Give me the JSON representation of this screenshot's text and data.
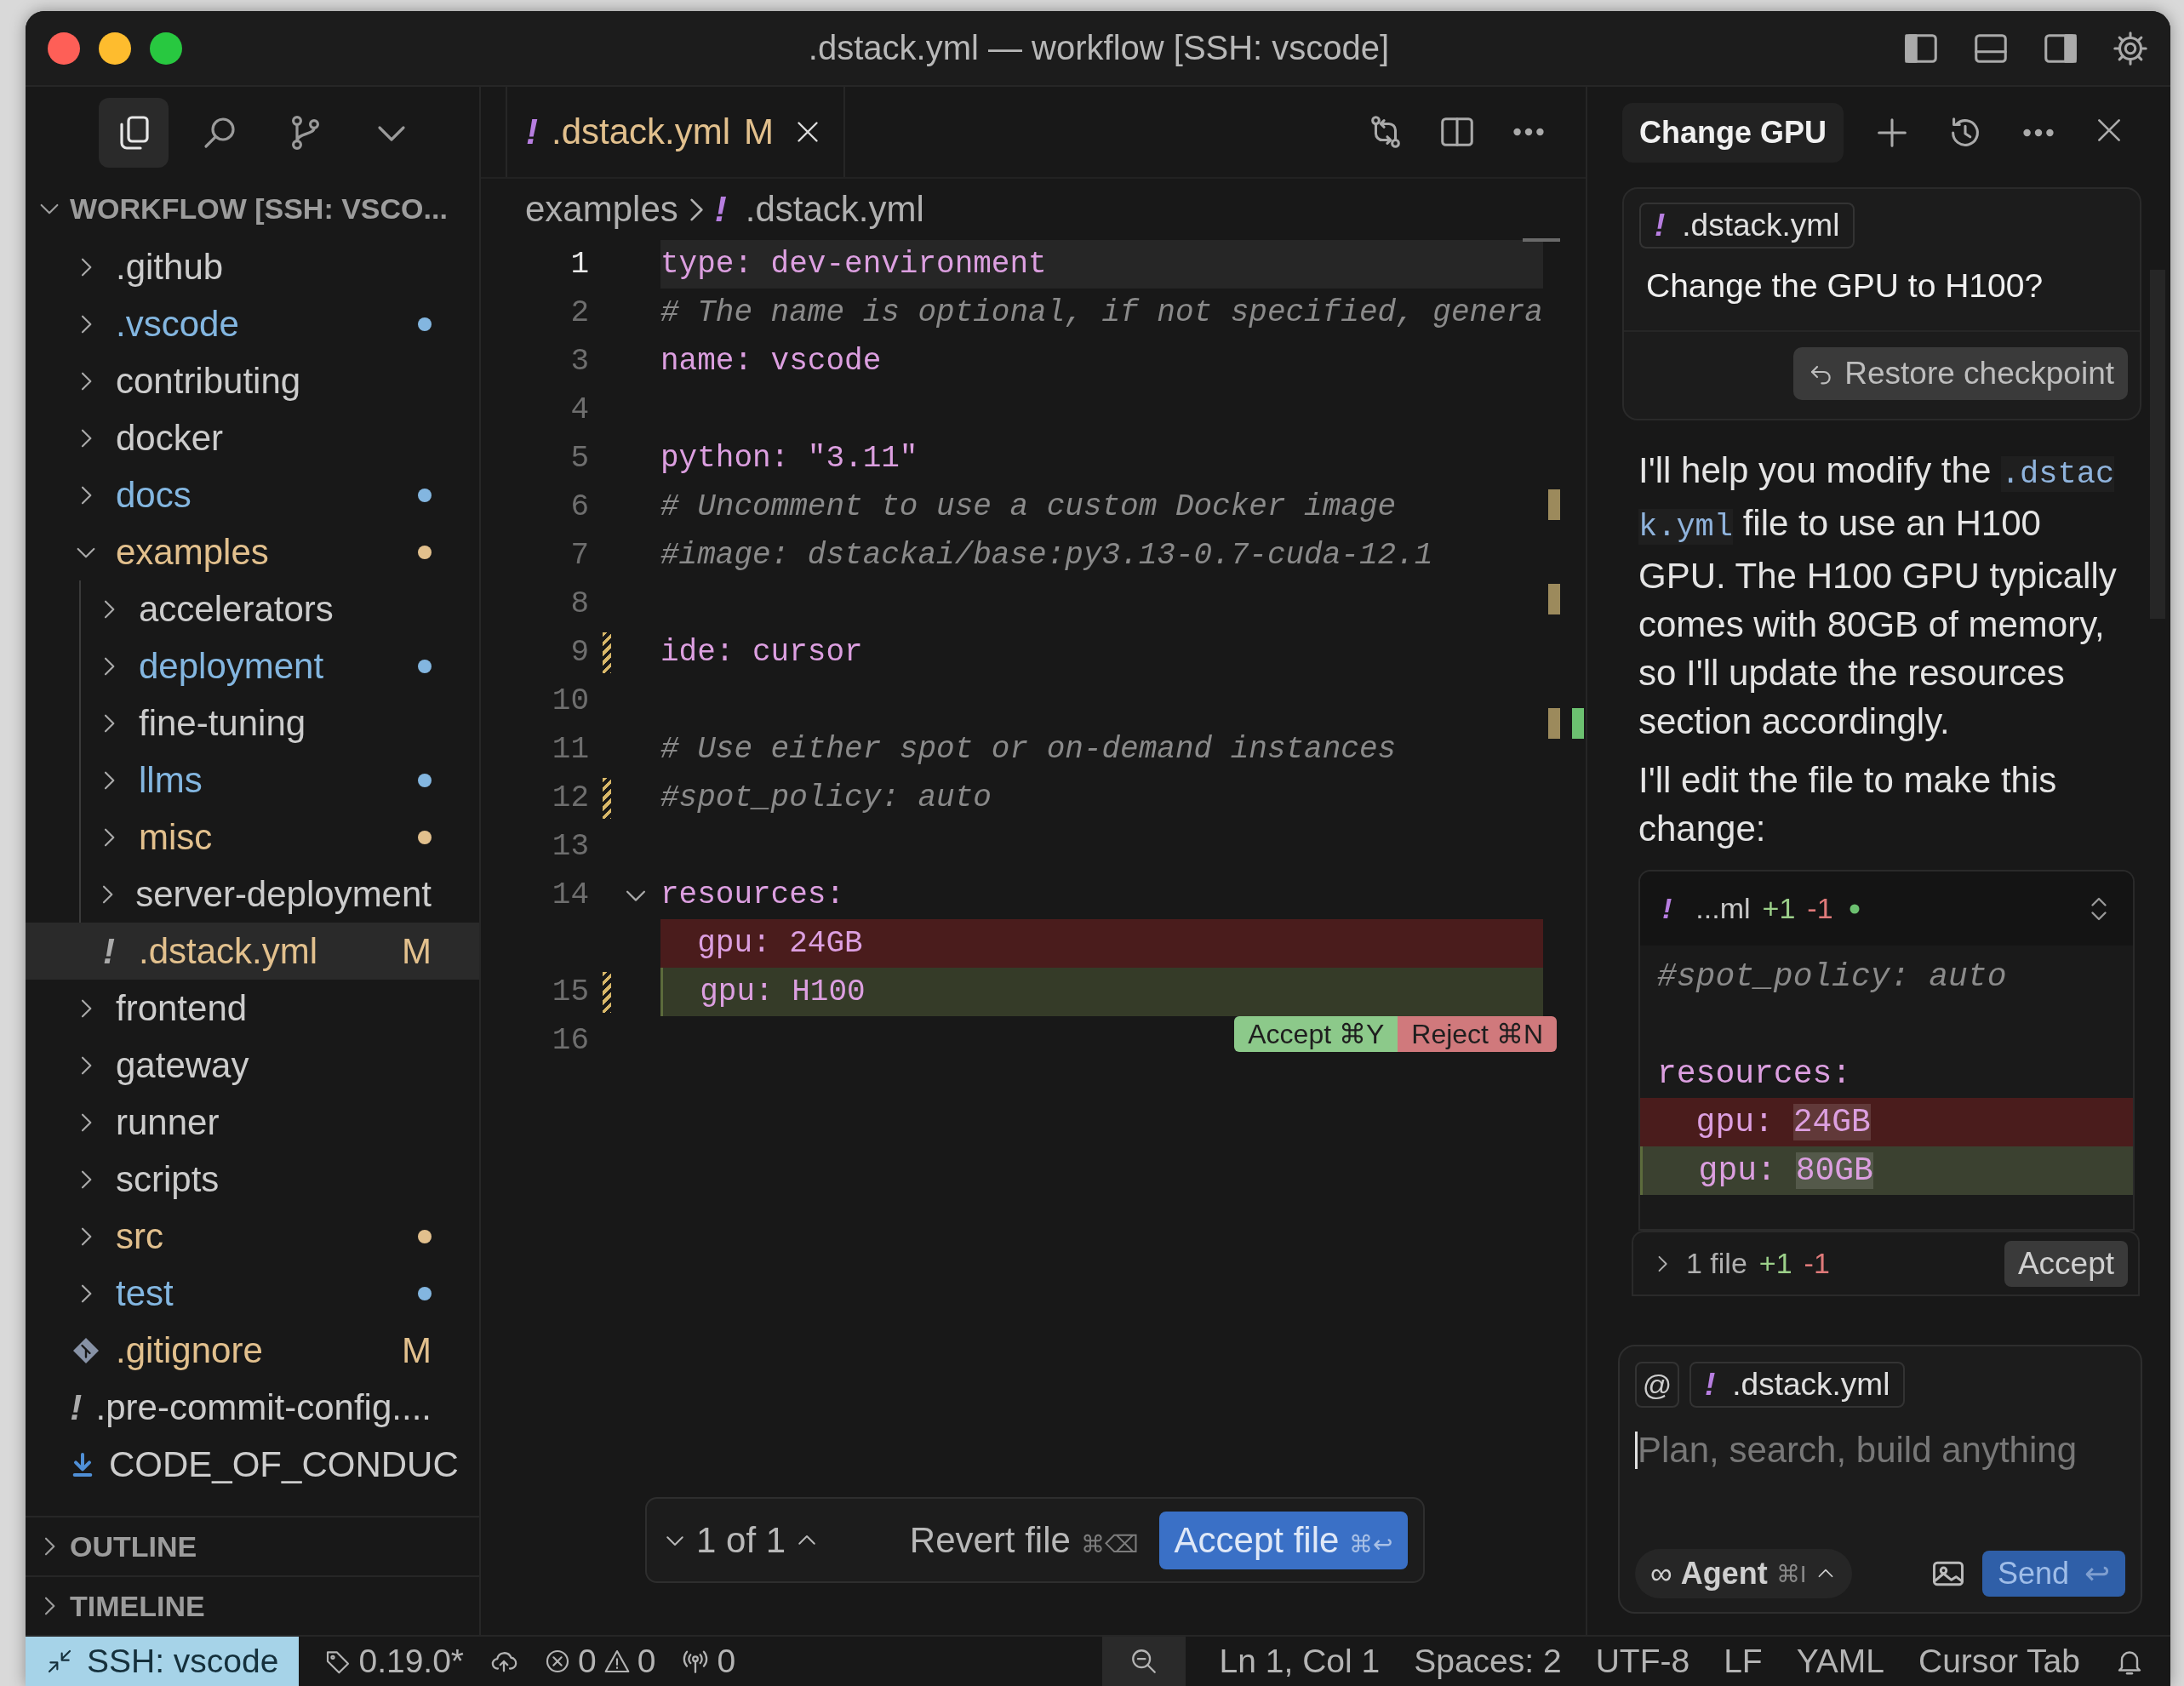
{
  "window": {
    "title": ".dstack.yml — workflow [SSH: vscode]"
  },
  "activity_bar": {
    "items": [
      {
        "kind": "explorer",
        "selected": true
      },
      {
        "kind": "search",
        "selected": false
      },
      {
        "kind": "source-control",
        "selected": false
      },
      {
        "kind": "more",
        "selected": false
      }
    ]
  },
  "explorer": {
    "title": "WORKFLOW [SSH: VSCO...",
    "expanded": true,
    "items": [
      {
        "label": ".github",
        "kind": "folder",
        "expanded": false,
        "selected": false
      },
      {
        "label": ".vscode",
        "kind": "folder",
        "expanded": false,
        "selected": false,
        "color": "#83b6e0"
      },
      {
        "label": "contributing",
        "kind": "folder",
        "expanded": false,
        "selected": false
      },
      {
        "label": "docker",
        "kind": "folder",
        "expanded": false,
        "selected": false
      },
      {
        "label": "docs",
        "kind": "folder",
        "expanded": false,
        "selected": false,
        "color": "#83b6e0"
      },
      {
        "label": "examples",
        "kind": "folder",
        "expanded": true,
        "selected": false,
        "color": "#e2c08d",
        "children": [
          {
            "label": "accelerators",
            "kind": "folder",
            "expanded": false,
            "selected": false
          },
          {
            "label": "deployment",
            "kind": "folder",
            "expanded": false,
            "selected": false,
            "color": "#83b6e0"
          },
          {
            "label": "fine-tuning",
            "kind": "folder",
            "expanded": false,
            "selected": false
          },
          {
            "label": "llms",
            "kind": "folder",
            "expanded": false,
            "selected": false,
            "color": "#83b6e0"
          },
          {
            "label": "misc",
            "kind": "folder",
            "expanded": false,
            "selected": false,
            "color": "#e2c08d"
          },
          {
            "label": "server-deployment",
            "kind": "folder",
            "expanded": false,
            "selected": false
          },
          {
            "label": ".dstack.yml",
            "kind": "yaml-file",
            "glyph": "!",
            "selected": true,
            "color": "#e2c08d",
            "badge": "M"
          }
        ]
      },
      {
        "label": "frontend",
        "kind": "folder",
        "expanded": false,
        "selected": false
      },
      {
        "label": "gateway",
        "kind": "folder",
        "expanded": false,
        "selected": false
      },
      {
        "label": "runner",
        "kind": "folder",
        "expanded": false,
        "selected": false
      },
      {
        "label": "scripts",
        "kind": "folder",
        "expanded": false,
        "selected": false
      },
      {
        "label": "src",
        "kind": "folder",
        "expanded": false,
        "selected": false,
        "color": "#e2c08d"
      },
      {
        "label": "test",
        "kind": "folder",
        "expanded": false,
        "selected": false,
        "color": "#83b6e0"
      },
      {
        "label": ".gitignore",
        "kind": "git-file",
        "selected": false,
        "color": "#e2c08d",
        "badge": "M"
      },
      {
        "label": ".pre-commit-config....",
        "kind": "yaml-file",
        "glyph": "!",
        "selected": false
      },
      {
        "label": "CODE_OF_CONDUC",
        "kind": "markdown-file",
        "selected": false
      }
    ]
  },
  "panels": [
    {
      "title": "OUTLINE",
      "expanded": false
    },
    {
      "title": "TIMELINE",
      "expanded": false
    }
  ],
  "editor": {
    "tabs": [
      {
        "glyph": "!",
        "label": ".dstack.yml",
        "badge": "M",
        "selected": true
      }
    ],
    "breadcrumb": [
      {
        "label": "examples"
      },
      {
        "glyph": "!",
        "label": ".dstack.yml"
      }
    ],
    "lines": [
      {
        "number": "1",
        "kind": "code",
        "text": "type: dev-environment",
        "current": true,
        "changed": false,
        "foldable": false
      },
      {
        "number": "2",
        "kind": "comment",
        "text": "# The name is optional, if not specified, genera",
        "current": false,
        "changed": false,
        "foldable": false
      },
      {
        "number": "3",
        "kind": "code",
        "text": "name: vscode",
        "current": false,
        "changed": false,
        "foldable": false
      },
      {
        "number": "4",
        "kind": "blank",
        "current": false,
        "changed": false,
        "foldable": false
      },
      {
        "number": "5",
        "kind": "code",
        "text": "python: \"3.11\"",
        "current": false,
        "changed": false,
        "foldable": false
      },
      {
        "number": "6",
        "kind": "comment",
        "text": "# Uncomment to use a custom Docker image",
        "current": false,
        "changed": false,
        "foldable": false
      },
      {
        "number": "7",
        "kind": "comment",
        "text": "#image: dstackai/base:py3.13-0.7-cuda-12.1",
        "current": false,
        "changed": false,
        "foldable": false
      },
      {
        "number": "8",
        "kind": "blank",
        "current": false,
        "changed": false,
        "foldable": false
      },
      {
        "number": "9",
        "kind": "code",
        "text": "ide: cursor",
        "current": false,
        "changed": true,
        "foldable": false
      },
      {
        "number": "10",
        "kind": "blank",
        "current": false,
        "changed": false,
        "foldable": false
      },
      {
        "number": "11",
        "kind": "comment",
        "text": "# Use either spot or on-demand instances",
        "current": false,
        "changed": false,
        "foldable": false
      },
      {
        "number": "12",
        "kind": "comment",
        "text": "#spot_policy: auto",
        "current": false,
        "changed": true,
        "foldable": false
      },
      {
        "number": "13",
        "kind": "blank",
        "current": false,
        "changed": false,
        "foldable": false
      },
      {
        "number": "14",
        "kind": "code",
        "text": "resources:",
        "current": false,
        "changed": false,
        "foldable": true
      },
      {
        "kind": "deleted",
        "text": "  gpu: 24GB",
        "current": false,
        "changed": false,
        "foldable": false
      },
      {
        "number": "15",
        "kind": "added",
        "text": "  gpu: H100",
        "current": false,
        "changed": true,
        "foldable": false
      },
      {
        "number": "16",
        "kind": "blank",
        "current": false,
        "changed": false,
        "foldable": false
      }
    ],
    "inline_actions": [
      {
        "kind": "accept",
        "label": "Accept ⌘Y"
      },
      {
        "kind": "reject",
        "label": "Reject ⌘N"
      }
    ],
    "review_bar": {
      "position": "1 of 1",
      "revert": {
        "label": "Revert file",
        "shortcut": "⌘⌫"
      },
      "accept": {
        "label": "Accept file",
        "shortcut": "⌘↩"
      }
    }
  },
  "chat": {
    "tabs": [
      {
        "label": "Change GPU",
        "selected": true
      }
    ],
    "user_message": {
      "attachment": {
        "glyph": "!",
        "label": ".dstack.yml"
      },
      "text": "Change the GPU to H100?",
      "restore_button": "Restore checkpoint"
    },
    "assistant_paragraphs": [
      {
        "parts": [
          {
            "kind": "text",
            "text": "I'll help you modify the "
          },
          {
            "kind": "code",
            "text": ".dstack.yml"
          },
          {
            "kind": "text",
            "text": " file to use an H100 GPU. The H100 GPU typically comes with 80GB of memory, so I'll update the resources section accordingly."
          }
        ]
      },
      {
        "parts": [
          {
            "kind": "text",
            "text": "I'll edit the file to make this change:"
          }
        ]
      }
    ],
    "diff_block": {
      "glyph": "!",
      "file": "...ml",
      "added": "+1",
      "removed": "-1",
      "lines": [
        {
          "kind": "comment",
          "text": "#spot_policy: auto"
        },
        {
          "kind": "blank"
        },
        {
          "kind": "code",
          "text": "resources:"
        },
        {
          "kind": "deleted",
          "text": "  gpu: ",
          "highlight": "24GB"
        },
        {
          "kind": "added",
          "text": "  gpu: ",
          "highlight": "80GB"
        }
      ]
    },
    "summary": {
      "files": "1 file",
      "added": "+1",
      "removed": "-1",
      "accept_button": "Accept",
      "expanded": false
    },
    "composer": {
      "mention_button": "@",
      "attachment": {
        "glyph": "!",
        "label": ".dstack.yml"
      },
      "placeholder": "Plan, search, build anything",
      "mode": {
        "glyph": "∞",
        "label": "Agent",
        "shortcut": "⌘I"
      },
      "send": {
        "label": "Send",
        "shortcut": "↩"
      }
    }
  },
  "status_bar": {
    "remote": "SSH: vscode",
    "version": "0.19.0*",
    "errors": "0",
    "warnings": "0",
    "ports": "0",
    "position": "Ln 1, Col 1",
    "indentation": "Spaces: 2",
    "encoding": "UTF-8",
    "eol": "LF",
    "language": "YAML",
    "cursor_tab": "Cursor Tab"
  }
}
